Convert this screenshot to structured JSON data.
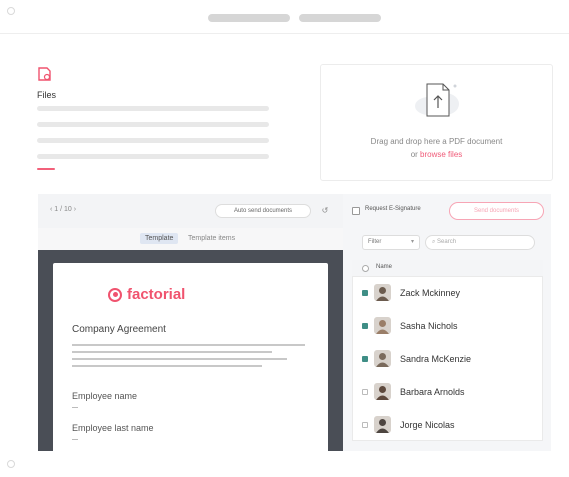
{
  "files": {
    "title": "Files"
  },
  "dropzone": {
    "text": "Drag and drop here a PDF document",
    "or_text": "or",
    "link": "browse files"
  },
  "toolbar": {
    "pager": "1 / 10",
    "auto_send": "Auto send documents",
    "undo": "↺"
  },
  "tabs": {
    "template": "Template",
    "template_items": "Template items"
  },
  "document": {
    "brand": "factorial",
    "heading": "Company Agreement",
    "field_1": "Employee name",
    "field_2": "Employee last name"
  },
  "signers": {
    "request_label": "Request E-Signature",
    "send_button": "Send documents",
    "filter": "Filter",
    "search_placeholder": "Search",
    "column_name": "Name",
    "rows": [
      {
        "name": "Zack Mckinney",
        "checked": true,
        "avatar_color": "#6b5b4e"
      },
      {
        "name": "Sasha Nichols",
        "checked": true,
        "avatar_color": "#9a7e68"
      },
      {
        "name": "Sandra McKenzie",
        "checked": true,
        "avatar_color": "#7a6a5c"
      },
      {
        "name": "Barbara Arnolds",
        "checked": false,
        "avatar_color": "#5e4a3e"
      },
      {
        "name": "Jorge Nicolas",
        "checked": false,
        "avatar_color": "#4d4540"
      }
    ]
  },
  "colors": {
    "accent": "#f0536e",
    "check": "#3f8e86",
    "doc_frame": "#4a4e56"
  }
}
